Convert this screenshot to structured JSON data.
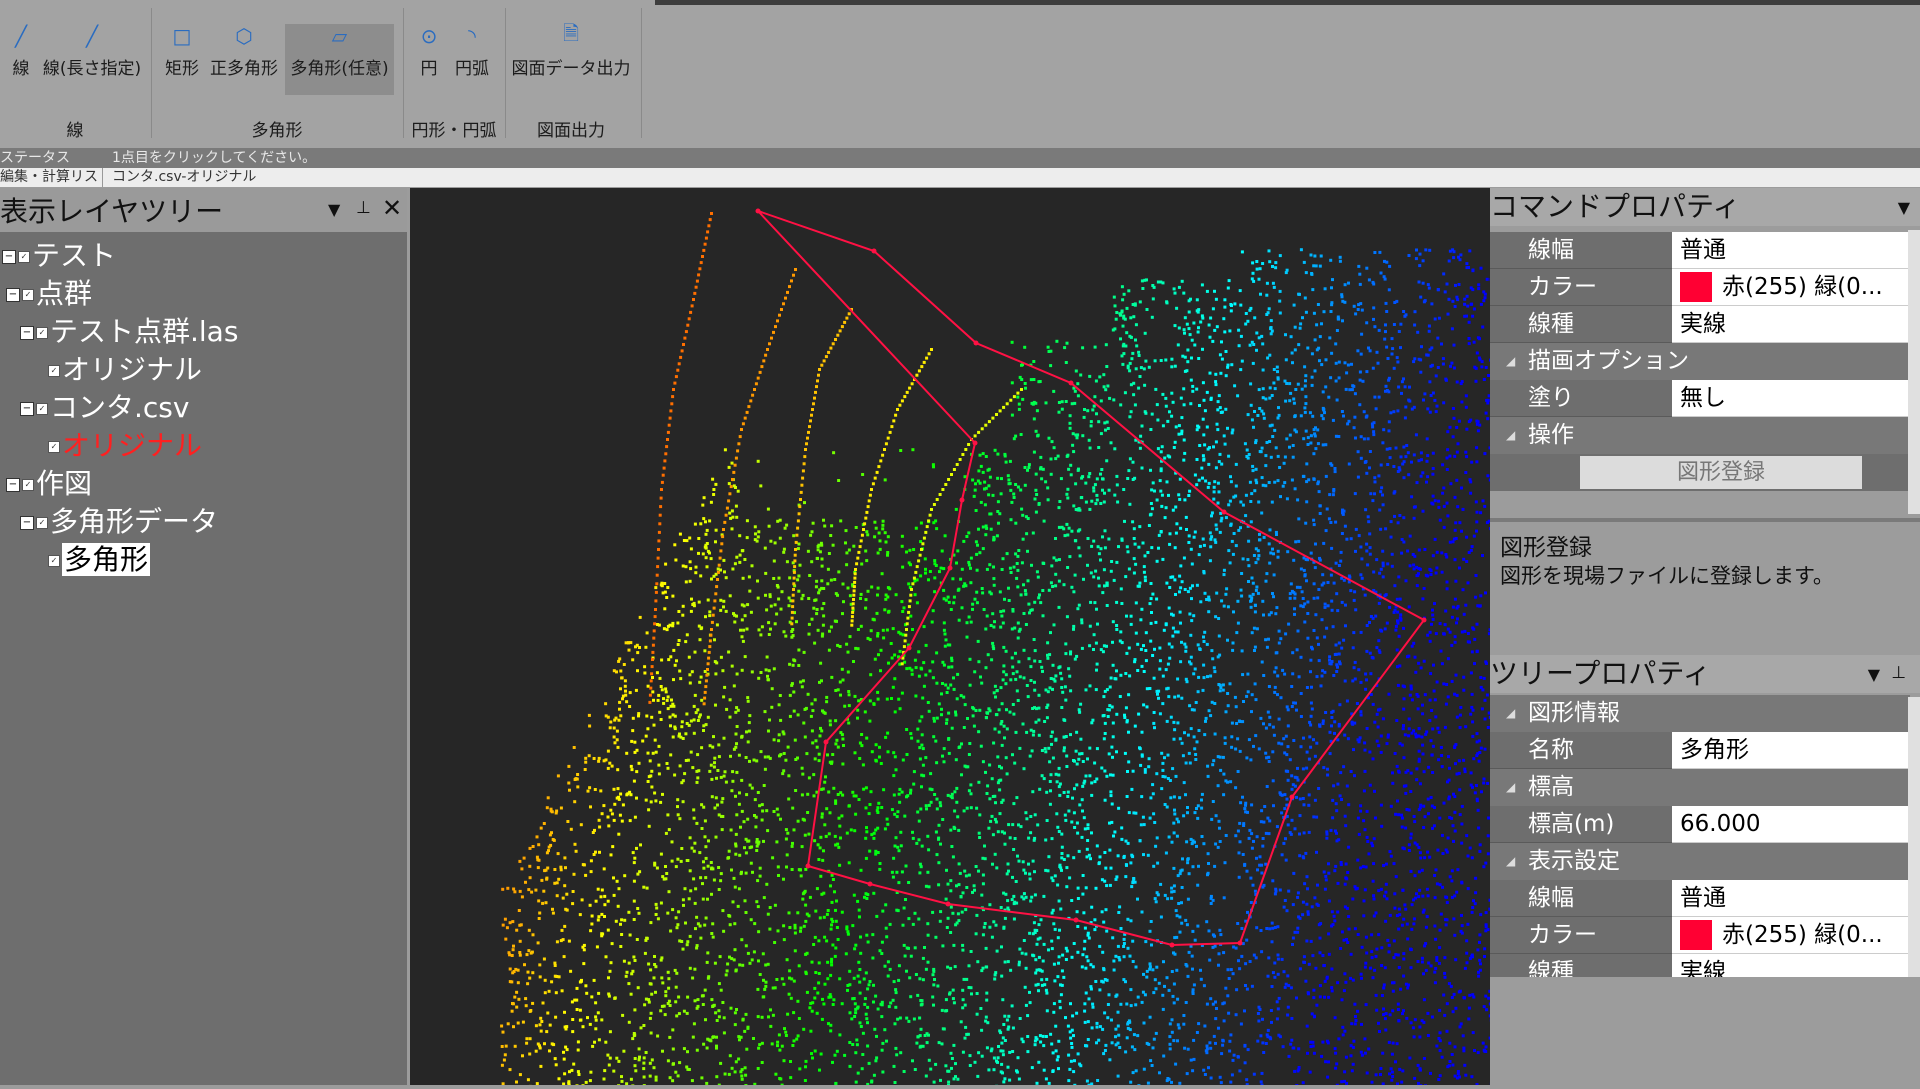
{
  "ribbon": {
    "groups": [
      {
        "label": "線",
        "buttons": [
          {
            "label": "線"
          },
          {
            "label": "線(長さ指定)"
          }
        ]
      },
      {
        "label": "多角形",
        "buttons": [
          {
            "label": "矩形"
          },
          {
            "label": "正多角形"
          },
          {
            "label": "多角形(任意)"
          }
        ]
      },
      {
        "label": "円形・円弧",
        "buttons": [
          {
            "label": "円"
          },
          {
            "label": "円弧"
          }
        ]
      },
      {
        "label": "図面出力",
        "buttons": [
          {
            "label": "図面データ出力"
          }
        ]
      }
    ]
  },
  "status": {
    "label": "ステータス",
    "message": "1点目をクリックしてください。"
  },
  "tabs": {
    "edit": "編集・計算リス",
    "doc": "コンタ.csv-オリジナル"
  },
  "layer_tree": {
    "title": "表示レイヤツリー",
    "items": [
      "テスト",
      "点群",
      "テスト点群.las",
      "オリジナル",
      "コンタ.csv",
      "オリジナル",
      "作図",
      "多角形データ",
      "多角形"
    ]
  },
  "command_props": {
    "title": "コマンドプロパティ",
    "rows": [
      {
        "key": "線幅",
        "value": "普通"
      },
      {
        "key": "カラー",
        "value": "赤(255) 緑(0..."
      },
      {
        "key": "線種",
        "value": "実線"
      }
    ],
    "cat_draw": "描画オプション",
    "fill_key": "塗り",
    "fill_value": "無し",
    "cat_ops": "操作",
    "register_button": "図形登録",
    "desc_title": "図形登録",
    "desc_text": "図形を現場ファイルに登録します。",
    "swatch_color": "#ff0033"
  },
  "tree_props": {
    "title": "ツリープロパティ",
    "cat_info": "図形情報",
    "name_key": "名称",
    "name_value": "多角形",
    "cat_elev": "標高",
    "elev_key": "標高(m)",
    "elev_value": "66.000",
    "cat_display": "表示設定",
    "width_key": "線幅",
    "width_value": "普通",
    "color_key": "カラー",
    "color_value": "赤(255) 緑(0...",
    "type_key": "線種",
    "type_value": "実線"
  }
}
